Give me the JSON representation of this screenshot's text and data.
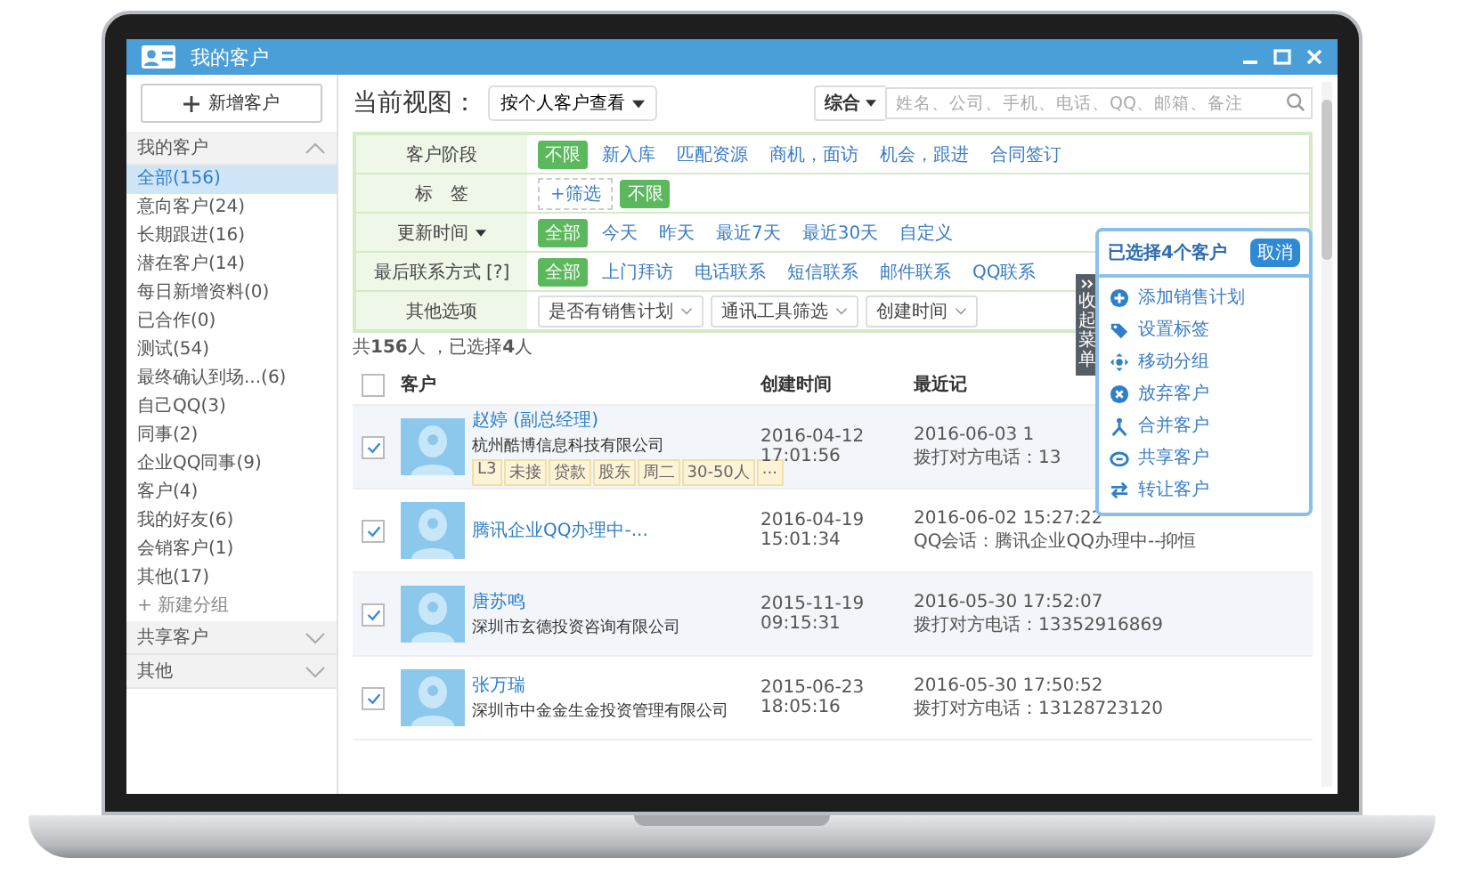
{
  "window": {
    "title": "我的客户"
  },
  "sidebar": {
    "new_button": "新增客户",
    "add_group": "+ 新建分组",
    "sections": [
      {
        "label": "我的客户",
        "expanded": true,
        "items": [
          {
            "label": "全部(156)",
            "selected": true
          },
          {
            "label": "意向客户(24)",
            "selected": false
          },
          {
            "label": "长期跟进(16)",
            "selected": false
          },
          {
            "label": "潜在客户(14)",
            "selected": false
          },
          {
            "label": "每日新增资料(0)",
            "selected": false
          },
          {
            "label": "已合作(0)",
            "selected": false
          },
          {
            "label": "测试(54)",
            "selected": false
          },
          {
            "label": "最终确认到场...(6)",
            "selected": false
          },
          {
            "label": "自己QQ(3)",
            "selected": false
          },
          {
            "label": "同事(2)",
            "selected": false
          },
          {
            "label": "企业QQ同事(9)",
            "selected": false
          },
          {
            "label": "客户(4)",
            "selected": false
          },
          {
            "label": "我的好友(6)",
            "selected": false
          },
          {
            "label": "会销客户(1)",
            "selected": false
          },
          {
            "label": "其他(17)",
            "selected": false
          }
        ]
      },
      {
        "label": "共享客户",
        "expanded": false
      },
      {
        "label": "其他",
        "expanded": false
      }
    ]
  },
  "view": {
    "label": "当前视图：",
    "dropdown": "按个人客户查看"
  },
  "search": {
    "scope": "综合",
    "placeholder": "姓名、公司、手机、电话、QQ、邮箱、备注"
  },
  "filters": [
    {
      "label": "客户阶段",
      "menu": false,
      "kind": "options",
      "options": [
        {
          "label": "不限",
          "selected": true
        },
        {
          "label": "新入库",
          "selected": false
        },
        {
          "label": "匹配资源",
          "selected": false
        },
        {
          "label": "商机，面访",
          "selected": false
        },
        {
          "label": "机会，跟进",
          "selected": false
        },
        {
          "label": "合同签订",
          "selected": false
        }
      ]
    },
    {
      "label": "标　签",
      "menu": false,
      "kind": "tags",
      "add": "+筛选",
      "options": [
        {
          "label": "不限",
          "selected": true
        }
      ]
    },
    {
      "label": "更新时间",
      "menu": true,
      "kind": "options",
      "options": [
        {
          "label": "全部",
          "selected": true
        },
        {
          "label": "今天",
          "selected": false
        },
        {
          "label": "昨天",
          "selected": false
        },
        {
          "label": "最近7天",
          "selected": false
        },
        {
          "label": "最近30天",
          "selected": false
        },
        {
          "label": "自定义",
          "selected": false
        }
      ]
    },
    {
      "label": "最后联系方式 [?]",
      "menu": false,
      "kind": "options",
      "options": [
        {
          "label": "全部",
          "selected": true
        },
        {
          "label": "上门拜访",
          "selected": false
        },
        {
          "label": "电话联系",
          "selected": false
        },
        {
          "label": "短信联系",
          "selected": false
        },
        {
          "label": "邮件联系",
          "selected": false
        },
        {
          "label": "QQ联系",
          "selected": false
        }
      ]
    },
    {
      "label": "其他选项",
      "menu": false,
      "kind": "selects",
      "selects": [
        "是否有销售计划",
        "通讯工具筛选",
        "创建时间"
      ]
    }
  ],
  "summary": "共**156**人 ，已选择**4**人",
  "table": {
    "header_checked": false,
    "columns": [
      "客户",
      "创建时间",
      "最近记"
    ],
    "rows": [
      {
        "checked": true,
        "name": "赵婷 (副总经理)",
        "company": "杭州酷博信息科技有限公司",
        "tags": [
          "L3",
          "未接",
          "贷款",
          "股东",
          "周二",
          "30-50人",
          "..."
        ],
        "created_date": "2016-04-12",
        "created_time": "17:01:56",
        "record_time": "2016-06-03 1",
        "record_text": "拨打对方电话：13"
      },
      {
        "checked": true,
        "name": "腾讯企业QQ办理中-...",
        "company": "",
        "tags": [],
        "created_date": "2016-04-19",
        "created_time": "15:01:34",
        "record_time": "2016-06-02 15:27:22",
        "record_text": "QQ会话：腾讯企业QQ办理中--抑恒"
      },
      {
        "checked": true,
        "name": "唐苏鸣",
        "company": "深圳市玄德投资咨询有限公司",
        "tags": [],
        "created_date": "2015-11-19",
        "created_time": "09:15:31",
        "record_time": "2016-05-30 17:52:07",
        "record_text": "拨打对方电话：13352916869"
      },
      {
        "checked": true,
        "name": "张万瑞",
        "company": "深圳市中金金生金投资管理有限公司",
        "tags": [],
        "created_date": "2015-06-23",
        "created_time": "18:05:16",
        "record_time": "2016-05-30 17:50:52",
        "record_text": "拨打对方电话：13128723120"
      }
    ]
  },
  "selection_panel": {
    "title": "已选择**4**个客户",
    "cancel": "取消",
    "collapse_tab": "收起菜单",
    "actions": [
      "添加销售计划",
      "设置标签",
      "移动分组",
      "放弃客户",
      "合并客户",
      "共享客户",
      "转让客户"
    ]
  }
}
